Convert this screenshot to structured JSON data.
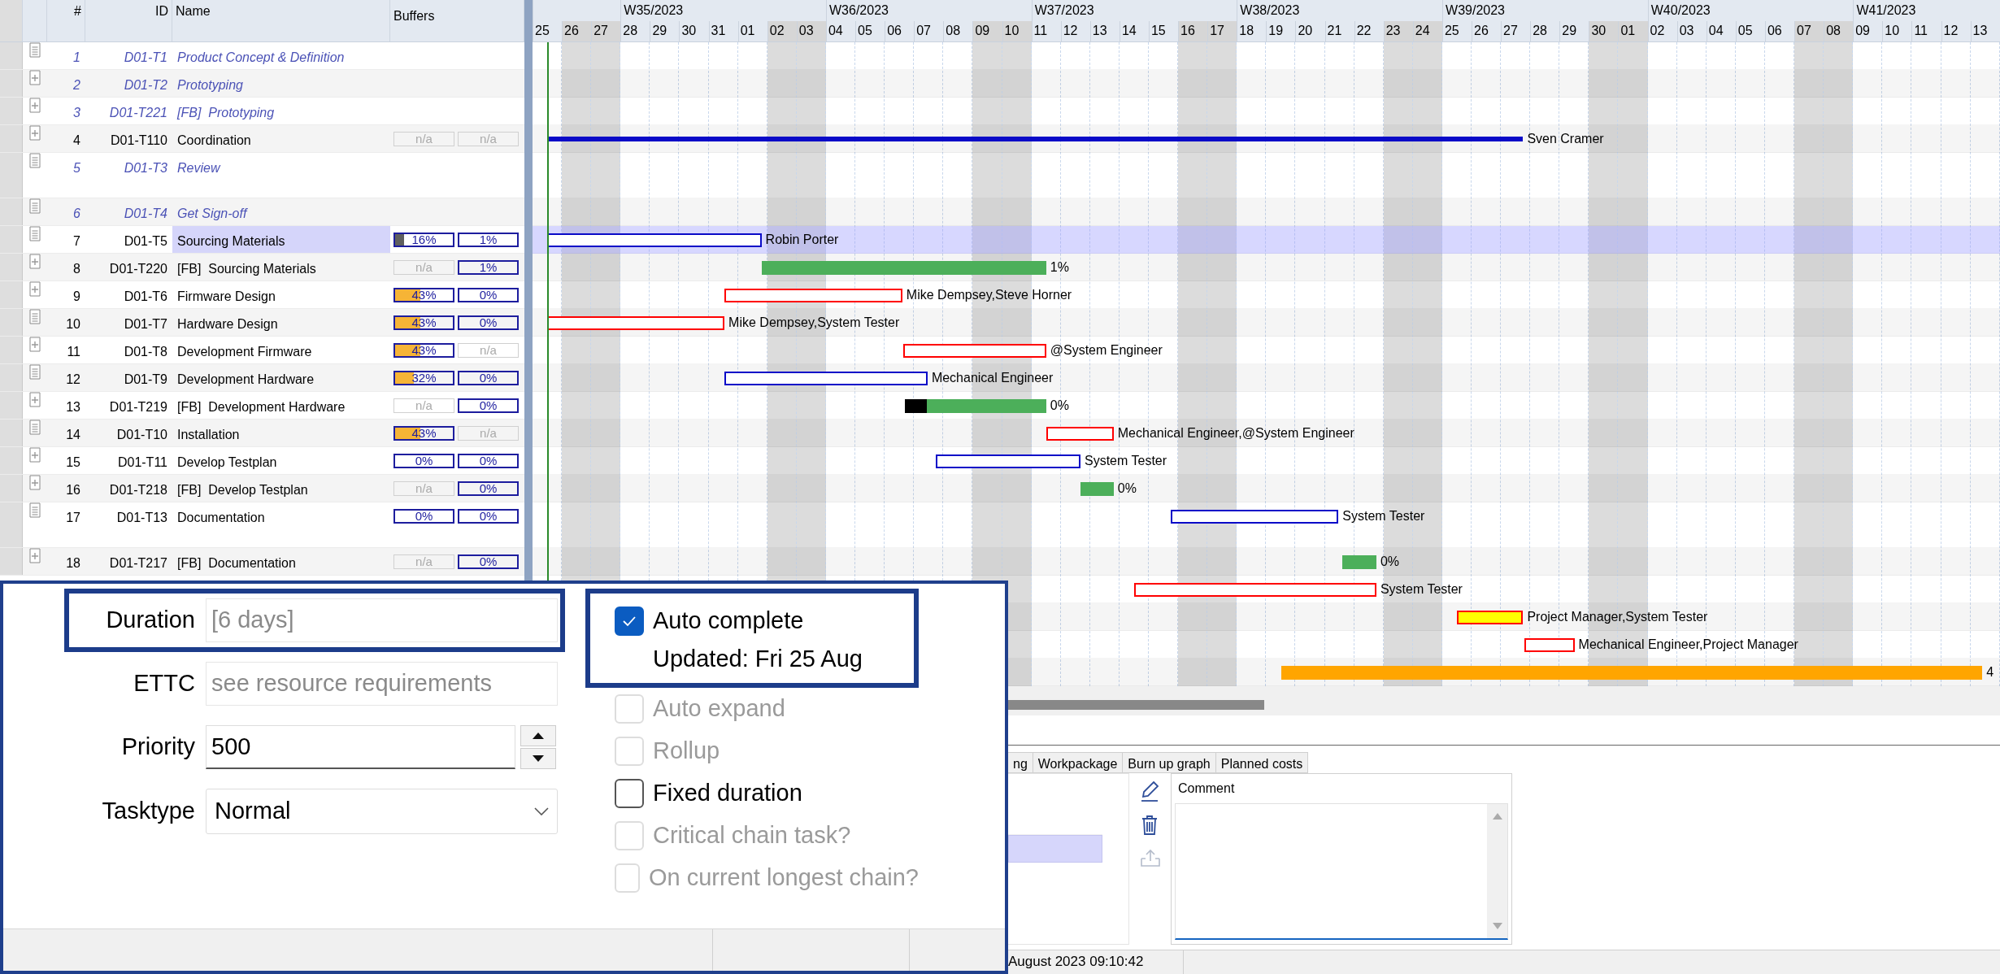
{
  "table": {
    "columns": [
      "#",
      "ID",
      "Name",
      "Buffers"
    ],
    "rows": [
      {
        "number": "1",
        "id": "D01-T1",
        "name": "Product Concept & Definition",
        "summary": true,
        "notes": true,
        "selected": false
      },
      {
        "number": "2",
        "id": "D01-T2",
        "name": "Prototyping",
        "summary": true,
        "notes": false,
        "selected": false
      },
      {
        "number": "3",
        "id": "D01-T221",
        "name": "[FB]  Prototyping",
        "summary": true,
        "notes": false,
        "selected": false
      },
      {
        "number": "4",
        "id": "D01-T110",
        "name": "Coordination",
        "summary": false,
        "notes": false,
        "selected": false,
        "buffers": [
          {
            "text": "n/a",
            "active": false
          },
          {
            "text": "n/a",
            "active": false
          }
        ],
        "bar": {
          "kind": "summary",
          "label": "Sven Cramer"
        }
      },
      {
        "number": "5",
        "id": "D01-T3",
        "name": "Review",
        "summary": true,
        "notes": true,
        "selected": false
      },
      {
        "number": "6",
        "id": "D01-T4",
        "name": "Get Sign-off",
        "summary": true,
        "notes": true,
        "selected": false
      },
      {
        "number": "7",
        "id": "D01-T5",
        "name": "Sourcing Materials",
        "summary": false,
        "notes": true,
        "selected": true,
        "buffers": [
          {
            "text": "16%",
            "active": true,
            "level": 0.16,
            "color": "#5f5f5f"
          },
          {
            "text": "1%",
            "active": true
          }
        ],
        "bar": {
          "kind": "task",
          "label": "Robin Porter"
        }
      },
      {
        "number": "8",
        "id": "D01-T220",
        "name": "[FB]  Sourcing Materials",
        "summary": false,
        "notes": false,
        "selected": false,
        "buffers": [
          {
            "text": "n/a",
            "active": false
          },
          {
            "text": "1%",
            "active": true
          }
        ],
        "bar": {
          "kind": "buffer",
          "label": "1%"
        }
      },
      {
        "number": "9",
        "id": "D01-T6",
        "name": "Firmware Design",
        "summary": false,
        "notes": false,
        "selected": false,
        "buffers": [
          {
            "text": "43%",
            "active": true,
            "level": 0.43,
            "color": "#f6b436"
          },
          {
            "text": "0%",
            "active": true
          }
        ],
        "bar": {
          "kind": "critical",
          "label": "Mike Dempsey,Steve Horner"
        }
      },
      {
        "number": "10",
        "id": "D01-T7",
        "name": "Hardware Design",
        "summary": false,
        "notes": true,
        "selected": false,
        "buffers": [
          {
            "text": "43%",
            "active": true,
            "level": 0.43,
            "color": "#f6b436"
          },
          {
            "text": "0%",
            "active": true
          }
        ],
        "bar": {
          "kind": "critical",
          "label": "Mike Dempsey,System Tester"
        }
      },
      {
        "number": "11",
        "id": "D01-T8",
        "name": "Development Firmware",
        "summary": false,
        "notes": false,
        "selected": false,
        "buffers": [
          {
            "text": "43%",
            "active": true,
            "level": 0.43,
            "color": "#f6b436"
          },
          {
            "text": "n/a",
            "active": false
          }
        ],
        "bar": {
          "kind": "critical",
          "label": "@System Engineer"
        }
      },
      {
        "number": "12",
        "id": "D01-T9",
        "name": "Development Hardware",
        "summary": false,
        "notes": true,
        "selected": false,
        "buffers": [
          {
            "text": "32%",
            "active": true,
            "level": 0.32,
            "color": "#f6b436"
          },
          {
            "text": "0%",
            "active": true
          }
        ],
        "bar": {
          "kind": "task",
          "label": "Mechanical Engineer"
        }
      },
      {
        "number": "13",
        "id": "D01-T219",
        "name": "[FB]  Development Hardware",
        "summary": false,
        "notes": false,
        "selected": false,
        "buffers": [
          {
            "text": "n/a",
            "active": false
          },
          {
            "text": "0%",
            "active": true
          }
        ],
        "bar": {
          "kind": "buffer",
          "label": "0%",
          "level": 0.155
        }
      },
      {
        "number": "14",
        "id": "D01-T10",
        "name": "Installation",
        "summary": false,
        "notes": true,
        "selected": false,
        "buffers": [
          {
            "text": "43%",
            "active": true,
            "level": 0.43,
            "color": "#f6b436"
          },
          {
            "text": "n/a",
            "active": false
          }
        ],
        "bar": {
          "kind": "critical",
          "label": "Mechanical Engineer,@System Engineer"
        }
      },
      {
        "number": "15",
        "id": "D01-T11",
        "name": "Develop Testplan",
        "summary": false,
        "notes": false,
        "selected": false,
        "buffers": [
          {
            "text": "0%",
            "active": true
          },
          {
            "text": "0%",
            "active": true
          }
        ],
        "bar": {
          "kind": "task",
          "label": "System Tester"
        }
      },
      {
        "number": "16",
        "id": "D01-T218",
        "name": "[FB]  Develop Testplan",
        "summary": false,
        "notes": false,
        "selected": false,
        "buffers": [
          {
            "text": "n/a",
            "active": false
          },
          {
            "text": "0%",
            "active": true
          }
        ],
        "bar": {
          "kind": "buffer",
          "label": "0%"
        }
      },
      {
        "number": "17",
        "id": "D01-T13",
        "name": "Documentation",
        "summary": false,
        "notes": true,
        "selected": false,
        "buffers": [
          {
            "text": "0%",
            "active": true
          },
          {
            "text": "0%",
            "active": true
          }
        ],
        "bar": {
          "kind": "task",
          "label": "System Tester"
        }
      },
      {
        "number": "18",
        "id": "D01-T217",
        "name": "[FB]  Documentation",
        "summary": false,
        "notes": false,
        "selected": false,
        "buffers": [
          {
            "text": "n/a",
            "active": false
          },
          {
            "text": "0%",
            "active": true
          }
        ],
        "bar": {
          "kind": "buffer",
          "label": "0%"
        }
      },
      {
        "selected": false,
        "bar": {
          "kind": "critical",
          "label": "System Tester"
        }
      },
      {
        "selected": false,
        "bar": {
          "kind": "warning",
          "label": "Project Manager,System Tester"
        }
      },
      {
        "selected": false,
        "bar": {
          "kind": "critical",
          "label": "Mechanical Engineer,Project Manager"
        }
      },
      {
        "selected": false,
        "bar": {
          "kind": "project_buffer",
          "label": "4"
        }
      }
    ]
  },
  "timeline": {
    "days": [
      {
        "label": "25",
        "weekend": false
      },
      {
        "label": "26",
        "weekend": true
      },
      {
        "label": "27",
        "weekend": true
      },
      {
        "label": "28",
        "weekend": false,
        "week": "W35/2023"
      },
      {
        "label": "29",
        "weekend": false
      },
      {
        "label": "30",
        "weekend": false
      },
      {
        "label": "31",
        "weekend": false
      },
      {
        "label": "01",
        "weekend": false
      },
      {
        "label": "02",
        "weekend": true
      },
      {
        "label": "03",
        "weekend": true
      },
      {
        "label": "04",
        "weekend": false,
        "week": "W36/2023"
      },
      {
        "label": "05",
        "weekend": false
      },
      {
        "label": "06",
        "weekend": false
      },
      {
        "label": "07",
        "weekend": false
      },
      {
        "label": "08",
        "weekend": false
      },
      {
        "label": "09",
        "weekend": true
      },
      {
        "label": "10",
        "weekend": true
      },
      {
        "label": "11",
        "weekend": false,
        "week": "W37/2023"
      },
      {
        "label": "12",
        "weekend": false
      },
      {
        "label": "13",
        "weekend": false
      },
      {
        "label": "14",
        "weekend": false
      },
      {
        "label": "15",
        "weekend": false
      },
      {
        "label": "16",
        "weekend": true
      },
      {
        "label": "17",
        "weekend": true
      },
      {
        "label": "18",
        "weekend": false,
        "week": "W38/2023"
      },
      {
        "label": "19",
        "weekend": false
      },
      {
        "label": "20",
        "weekend": false
      },
      {
        "label": "21",
        "weekend": false
      },
      {
        "label": "22",
        "weekend": false
      },
      {
        "label": "23",
        "weekend": true
      },
      {
        "label": "24",
        "weekend": true
      },
      {
        "label": "25",
        "weekend": false,
        "week": "W39/2023"
      },
      {
        "label": "26",
        "weekend": false
      },
      {
        "label": "27",
        "weekend": false
      },
      {
        "label": "28",
        "weekend": false
      },
      {
        "label": "29",
        "weekend": false
      },
      {
        "label": "30",
        "weekend": true
      },
      {
        "label": "01",
        "weekend": true
      },
      {
        "label": "02",
        "weekend": false,
        "week": "W40/2023"
      },
      {
        "label": "03",
        "weekend": false
      },
      {
        "label": "04",
        "weekend": false
      },
      {
        "label": "05",
        "weekend": false
      },
      {
        "label": "06",
        "weekend": false
      },
      {
        "label": "07",
        "weekend": true
      },
      {
        "label": "08",
        "weekend": true
      },
      {
        "label": "09",
        "weekend": false,
        "week": "W41/2023"
      },
      {
        "label": "10",
        "weekend": false
      },
      {
        "label": "11",
        "weekend": false
      },
      {
        "label": "12",
        "weekend": false
      },
      {
        "label": "13",
        "weekend": false
      }
    ]
  },
  "detail": {
    "tabs": [
      {
        "label": "ng",
        "selected": false
      },
      {
        "label": "Workpackage",
        "selected": false
      },
      {
        "label": "Burn up graph",
        "selected": false
      },
      {
        "label": "Planned costs",
        "selected": false
      }
    ],
    "list_rows": [
      {
        "selected": false
      },
      {
        "selected": true
      }
    ],
    "tools": [
      {
        "kind": "edit",
        "disabled": false
      },
      {
        "kind": "delete",
        "disabled": false
      },
      {
        "kind": "upload",
        "disabled": true
      }
    ],
    "comment": {
      "label": "Comment"
    }
  },
  "status_bar": {
    "text": "August 2023 09:10:42"
  },
  "task_panel": {
    "fields": [
      {
        "label": "Duration",
        "kind": "text",
        "value": "[6 days]",
        "disabled": true,
        "highlighted": true
      },
      {
        "label": "ETTC",
        "kind": "text",
        "value": "see resource requirements",
        "disabled": true,
        "highlighted": false
      },
      {
        "label": "Priority",
        "kind": "spin",
        "value": "500",
        "disabled": false,
        "highlighted": false
      },
      {
        "label": "Tasktype",
        "kind": "select",
        "value": "Normal",
        "disabled": false,
        "highlighted": false
      }
    ],
    "options": [
      {
        "label": "Auto complete",
        "checked": true,
        "disabled": false,
        "highlighted": true,
        "note": "Updated: Fri 25 Aug"
      },
      {
        "label": "Auto expand",
        "checked": false,
        "disabled": true,
        "highlighted": false
      },
      {
        "label": "Rollup",
        "checked": false,
        "disabled": true,
        "highlighted": false
      },
      {
        "label": "Fixed duration",
        "checked": false,
        "disabled": false,
        "highlighted": false
      },
      {
        "label": "Critical chain task?",
        "checked": false,
        "disabled": true,
        "highlighted": false
      },
      {
        "label": "On current longest chain?",
        "checked": false,
        "disabled": true,
        "highlighted": false
      }
    ]
  }
}
